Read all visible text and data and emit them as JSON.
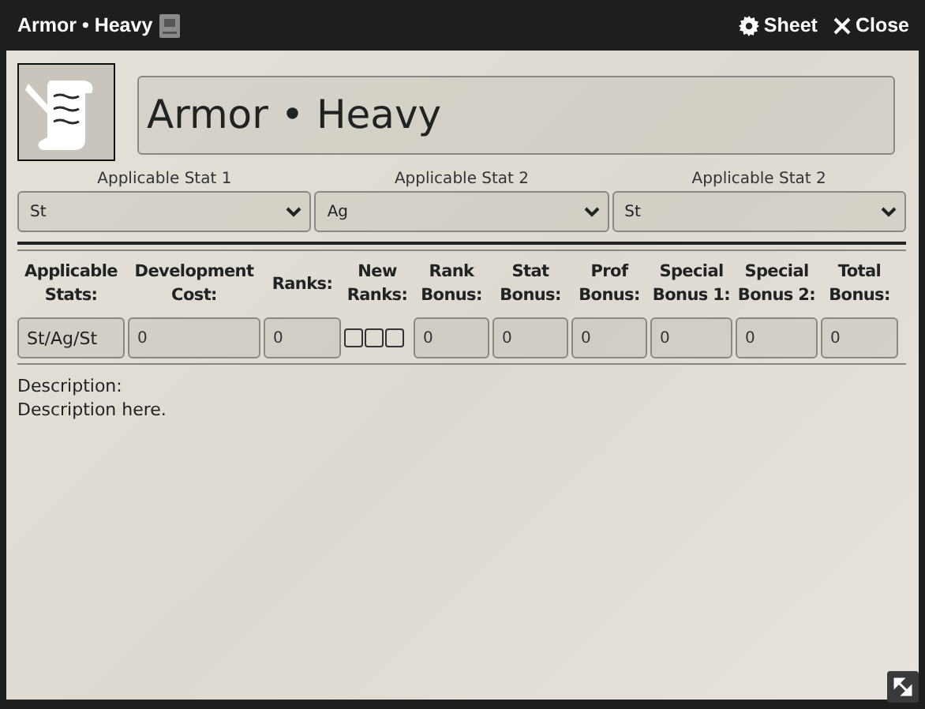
{
  "window": {
    "title": "Armor • Heavy",
    "actions": [
      {
        "kind": "sheet",
        "label": "Sheet"
      },
      {
        "kind": "close",
        "label": "Close"
      }
    ]
  },
  "name": "Armor • Heavy",
  "stat_selects": [
    {
      "label": "Applicable Stat 1",
      "value": "St"
    },
    {
      "label": "Applicable Stat 2",
      "value": "Ag"
    },
    {
      "label": "Applicable Stat 2",
      "value": "St"
    }
  ],
  "table": {
    "columns": [
      {
        "line1": "Applicable",
        "line2": "Stats:"
      },
      {
        "line1": "Development",
        "line2": "Cost:"
      },
      {
        "line1": "Ranks:"
      },
      {
        "line1": "New",
        "line2": "Ranks:"
      },
      {
        "line1": "Rank",
        "line2": "Bonus:"
      },
      {
        "line1": "Stat",
        "line2": "Bonus:"
      },
      {
        "line1": "Prof",
        "line2": "Bonus:"
      },
      {
        "line1": "Special",
        "line2": "Bonus 1:"
      },
      {
        "line1": "Special",
        "line2": "Bonus 2:"
      },
      {
        "line1": "Total",
        "line2": "Bonus:"
      }
    ],
    "cells": [
      {
        "kind": "label",
        "value": "St/Ag/St"
      },
      {
        "kind": "input",
        "value": "0"
      },
      {
        "kind": "input",
        "value": "0"
      },
      {
        "kind": "checkboxes",
        "boxes": [
          {
            "checked": false
          },
          {
            "checked": false
          },
          {
            "checked": false
          }
        ]
      },
      {
        "kind": "input",
        "value": "0"
      },
      {
        "kind": "input",
        "value": "0"
      },
      {
        "kind": "input",
        "value": "0"
      },
      {
        "kind": "input",
        "value": "0"
      },
      {
        "kind": "input",
        "value": "0"
      },
      {
        "kind": "input",
        "value": "0"
      }
    ]
  },
  "description": {
    "label": "Description:",
    "text": "Description here."
  }
}
